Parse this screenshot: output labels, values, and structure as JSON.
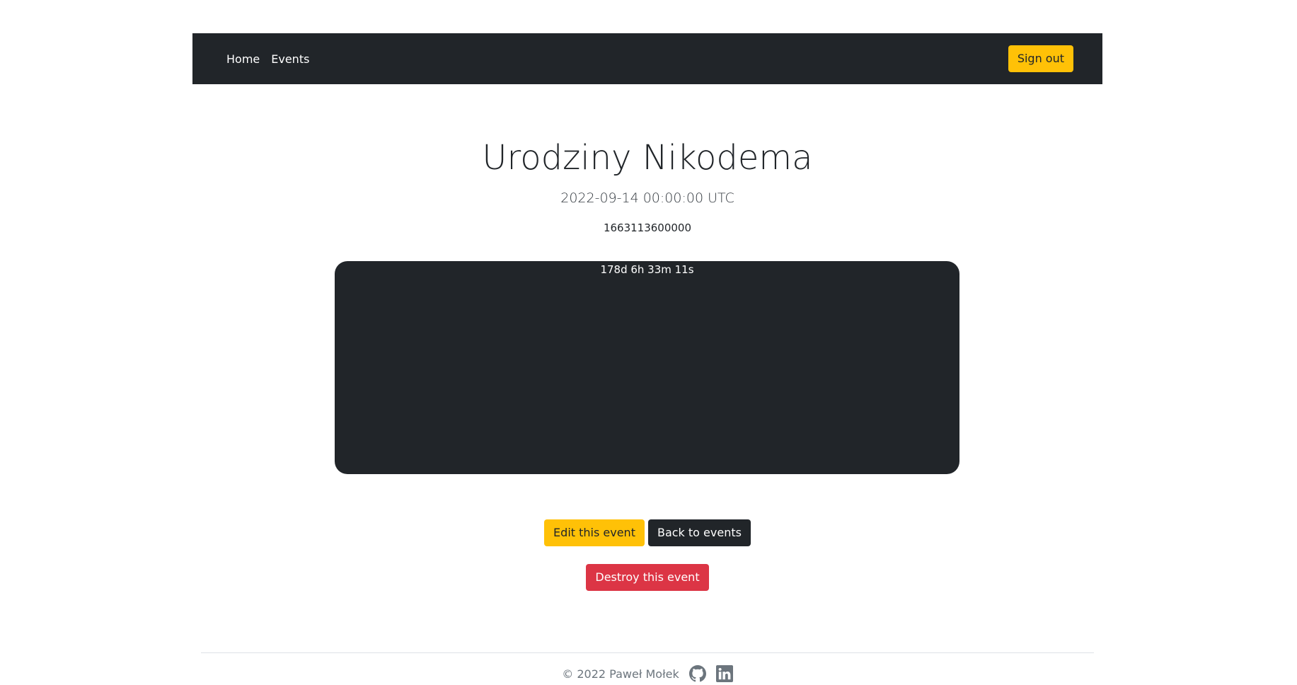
{
  "navbar": {
    "links": [
      "Home",
      "Events"
    ],
    "sign_out": "Sign out"
  },
  "event": {
    "title": "Urodziny Nikodema",
    "date": "2022-09-14 00:00:00 UTC",
    "timestamp": "1663113600000",
    "countdown": "178d 6h 33m 11s"
  },
  "actions": {
    "edit": "Edit this event",
    "back": "Back to events",
    "destroy": "Destroy this event"
  },
  "footer": {
    "copyright": "© 2022 Paweł Mołek",
    "icons": [
      "github-icon",
      "linkedin-icon"
    ]
  },
  "colors": {
    "dark": "#212529",
    "warning": "#ffc107",
    "danger": "#dc3545"
  }
}
